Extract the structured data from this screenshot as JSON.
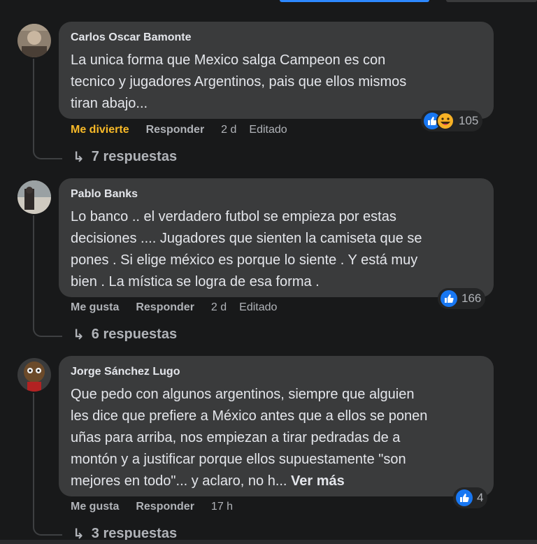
{
  "comments": [
    {
      "author": "Carlos Oscar Bamonte",
      "text_lines": [
        "La unica forma que Mexico salga Campeon es con",
        "tecnico y jugadores Argentinos, pais que ellos mismos",
        "tiran abajo..."
      ],
      "reaction_count": "105",
      "reaction_icons": [
        "like-icon",
        "haha-icon"
      ],
      "action_react": "Me divierte",
      "action_reply": "Responder",
      "time": "2 d",
      "edited": "Editado",
      "replies": "7 respuestas"
    },
    {
      "author": "Pablo Banks",
      "text_lines": [
        "Lo banco .. el verdadero futbol se empieza por estas",
        "decisiones .... Jugadores que sienten la camiseta que se",
        "pones . Si elige méxico es porque lo siente . Y está muy",
        "bien . La mística se logra de esa forma ."
      ],
      "reaction_count": "166",
      "reaction_icons": [
        "like-icon"
      ],
      "action_react": "Me gusta",
      "action_reply": "Responder",
      "time": "2 d",
      "edited": "Editado",
      "replies": "6 respuestas"
    },
    {
      "author": "Jorge Sánchez Lugo",
      "text_lines": [
        "Que pedo con algunos argentinos, siempre que alguien",
        "les dice que prefiere a México antes que a ellos se ponen",
        "uñas para arriba, nos empiezan a tirar pedradas de a",
        "montón y a justificar porque ellos supuestamente \"son",
        "mejores en todo\"... y aclaro, no h..."
      ],
      "see_more": "Ver más",
      "reaction_count": "4",
      "reaction_icons": [
        "like-icon"
      ],
      "action_react": "Me gusta",
      "action_reply": "Responder",
      "time": "17 h",
      "replies": "3 respuestas"
    }
  ],
  "colors": {
    "background": "#18191a",
    "bubble": "#3a3b3c",
    "text": "#e4e6eb",
    "secondary_text": "#b0b3b8",
    "like_blue": "#1877f2",
    "haha_yellow": "#f7b928"
  }
}
